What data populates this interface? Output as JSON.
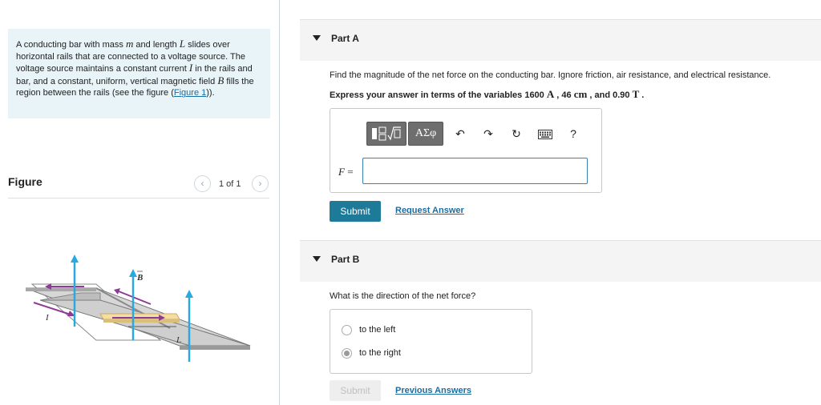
{
  "problem": {
    "text_1": "A conducting bar with mass ",
    "var_m": "m",
    "text_2": " and length ",
    "var_L": "L",
    "text_3": " slides over horizontal rails that are connected to a voltage source. The voltage source maintains a constant current ",
    "var_I": "I",
    "text_4": " in the rails and bar, and a constant, uniform, vertical magnetic field ",
    "var_B": "B",
    "text_5": " fills the region between the rails (see the figure (",
    "figure_link": "Figure 1",
    "text_6": "))."
  },
  "figure_panel": {
    "title": "Figure",
    "prev_icon": "chevron-left-icon",
    "next_icon": "chevron-right-icon",
    "pager": "1 of 1",
    "label_B": "B",
    "label_I": "I",
    "label_L": "L"
  },
  "partA": {
    "title": "Part A",
    "question": "Find the magnitude of the net force on the conducting bar. Ignore friction, air resistance, and electrical resistance.",
    "instr_pre": "Express your answer in terms of the variables 1600 ",
    "unit_A": "A",
    "sep1": " , 46 ",
    "unit_cm": "cm",
    "sep2": " , and 0.90 ",
    "unit_T": "T",
    "instr_end": " .",
    "toolbar": {
      "templates_icon": "templates-icon",
      "symbols_label": "ΑΣφ",
      "undo_icon": "undo-icon",
      "redo_icon": "redo-icon",
      "reset_icon": "reset-icon",
      "keyboard_icon": "keyboard-icon",
      "help_label": "?"
    },
    "answer_var": "F",
    "answer_eq": " =",
    "answer_value": "",
    "submit_label": "Submit",
    "request_label": "Request Answer"
  },
  "partB": {
    "title": "Part B",
    "question": "What is the direction of the net force?",
    "choices": [
      {
        "label": "to the left",
        "selected": false
      },
      {
        "label": "to the right",
        "selected": true
      }
    ],
    "submit_label": "Submit",
    "previous_label": "Previous Answers"
  },
  "colors": {
    "problem_bg": "#e8f4f7",
    "submit_bg": "#1e7a99",
    "link": "#1a6da0",
    "field_arrow": "#29a9e0",
    "force_arrow": "#8e3b96",
    "bar": "#f4dfa0"
  }
}
